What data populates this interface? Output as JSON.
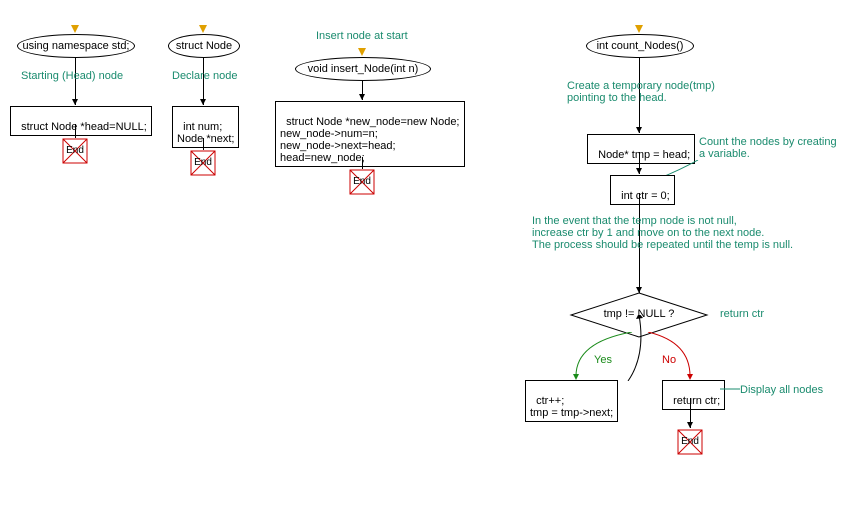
{
  "flow1": {
    "header": "using namespace std;",
    "annotation": "Starting (Head) node",
    "stmt": "struct Node *head=NULL;",
    "end": "End"
  },
  "flow2": {
    "header": "struct Node",
    "annotation": "Declare node",
    "stmt": "int num;\nNode *next;",
    "end": "End"
  },
  "flow3": {
    "annotation_top": "Insert node at start",
    "header": "void insert_Node(int n)",
    "stmt": "struct Node *new_node=new Node;\nnew_node->num=n;\nnew_node->next=head;\nhead=new_node;",
    "end": "End"
  },
  "flow4": {
    "header": "int count_Nodes()",
    "annotation1": "Create a temporary node(tmp)\npointing to the head.",
    "stmt1": "Node* tmp = head;",
    "annotation2": "Count the nodes by creating\na variable.",
    "stmt2": "int ctr = 0;",
    "annotation3": "In the event that the temp node is not null,\nincrease ctr by 1 and move on to the next node.\nThe process should be repeated until the temp is null.",
    "decision": "tmp != NULL ?",
    "annotation_return": "return ctr",
    "yes": "Yes",
    "no": "No",
    "stmt_yes": "ctr++;\ntmp = tmp->next;",
    "stmt_no": "return ctr;",
    "annotation_display": "Display all nodes",
    "end": "End"
  }
}
